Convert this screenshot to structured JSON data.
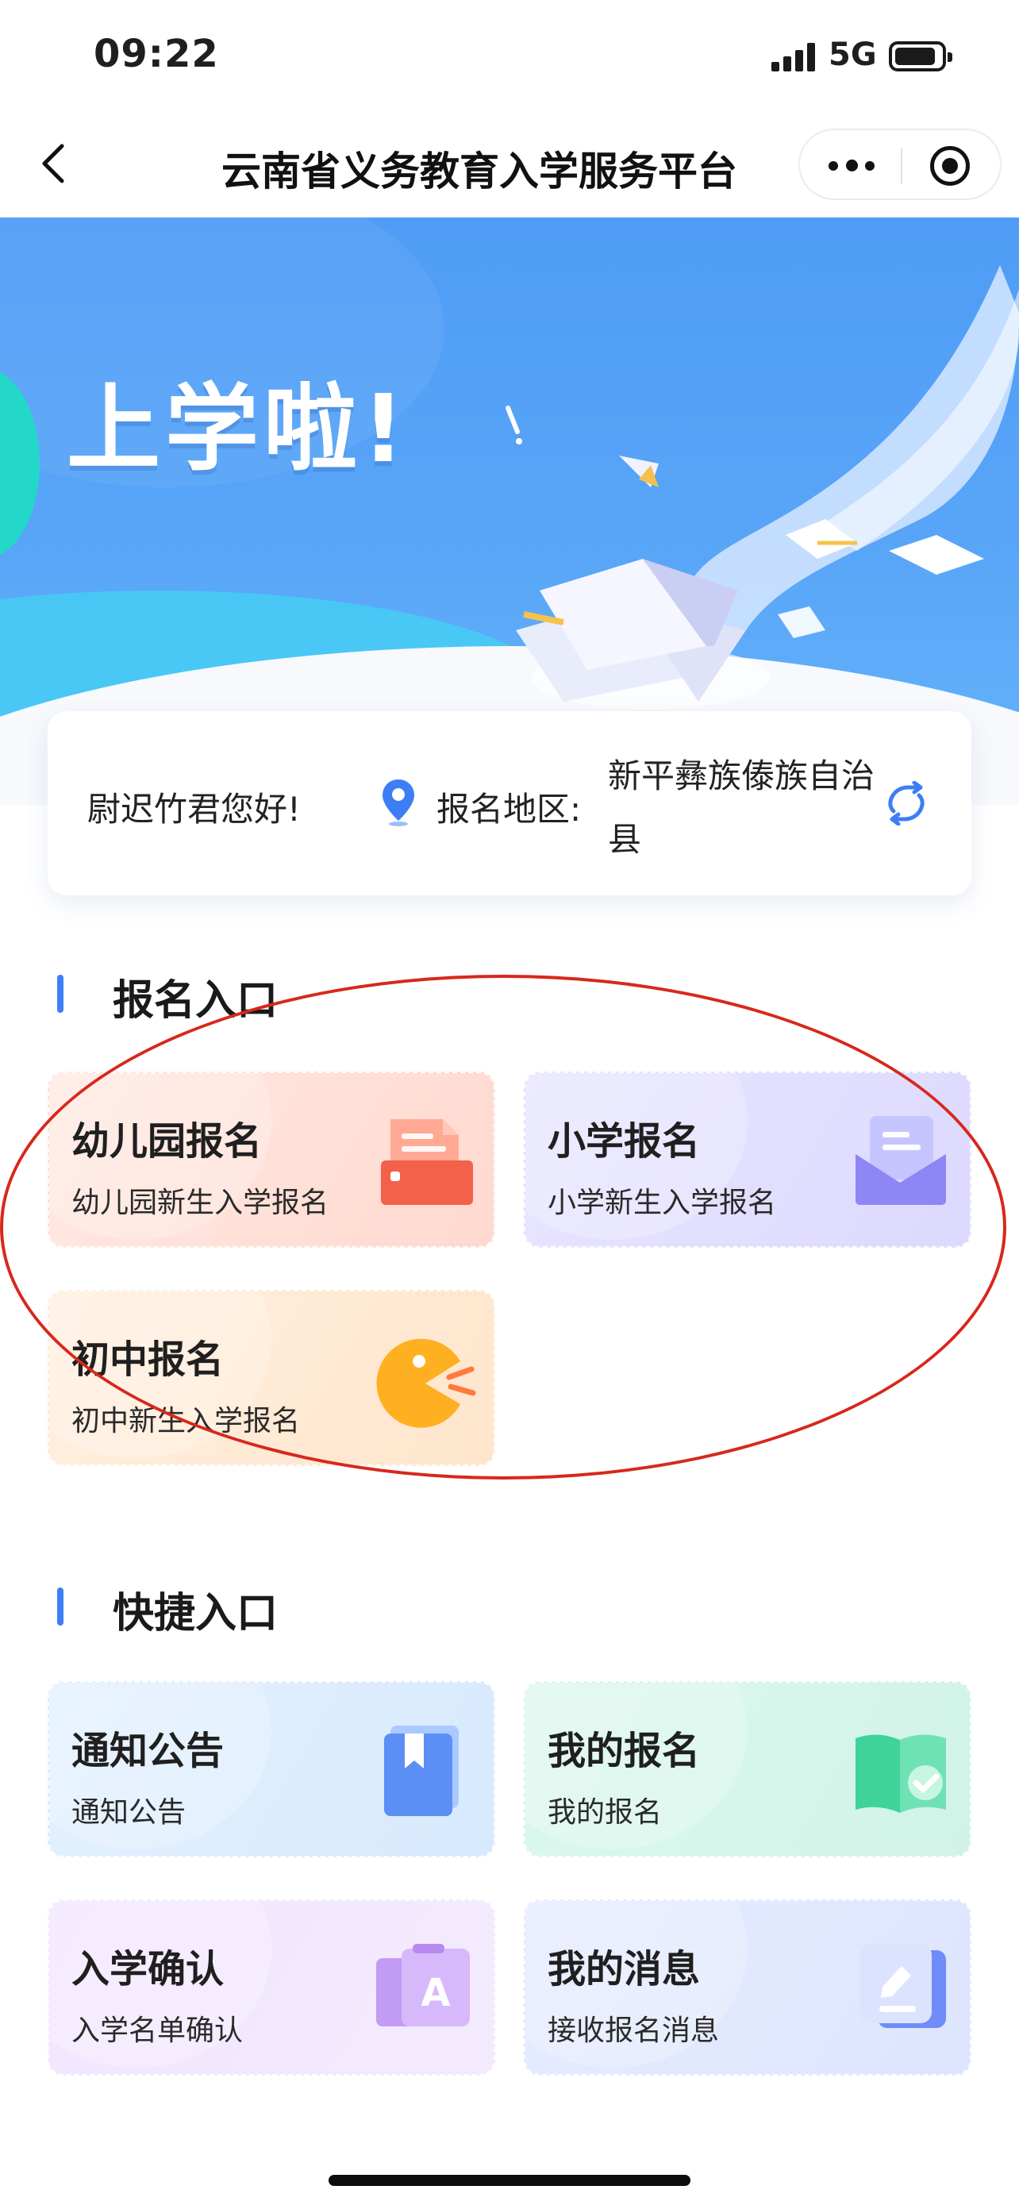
{
  "status_bar": {
    "time": "09:22",
    "network": "5G"
  },
  "nav": {
    "title": "云南省义务教育入学服务平台"
  },
  "banner": {
    "headline": "上学啦!"
  },
  "greeting": {
    "hello": "尉迟竹君您好!",
    "region_label": "报名地区:",
    "region_value": "新平彝族傣族自治县"
  },
  "registration": {
    "title": "报名入口",
    "items": [
      {
        "title": "幼儿园报名",
        "subtitle": "幼儿园新生入学报名",
        "icon": "drawer-icon"
      },
      {
        "title": "小学报名",
        "subtitle": "小学新生入学报名",
        "icon": "envelope-icon"
      },
      {
        "title": "初中报名",
        "subtitle": "初中新生入学报名",
        "icon": "pacman-icon"
      }
    ]
  },
  "shortcuts": {
    "title": "快捷入口",
    "items": [
      {
        "title": "通知公告",
        "subtitle": "通知公告",
        "icon": "bookmark-book-icon"
      },
      {
        "title": "我的报名",
        "subtitle": "我的报名",
        "icon": "open-book-check-icon"
      },
      {
        "title": "入学确认",
        "subtitle": "入学名单确认",
        "icon": "letter-a-cards-icon"
      },
      {
        "title": "我的消息",
        "subtitle": "接收报名消息",
        "icon": "edit-note-icon"
      }
    ]
  },
  "colors": {
    "accent": "#3d7ef7",
    "annotation": "#d7281c",
    "banner": "#58a5f8"
  }
}
